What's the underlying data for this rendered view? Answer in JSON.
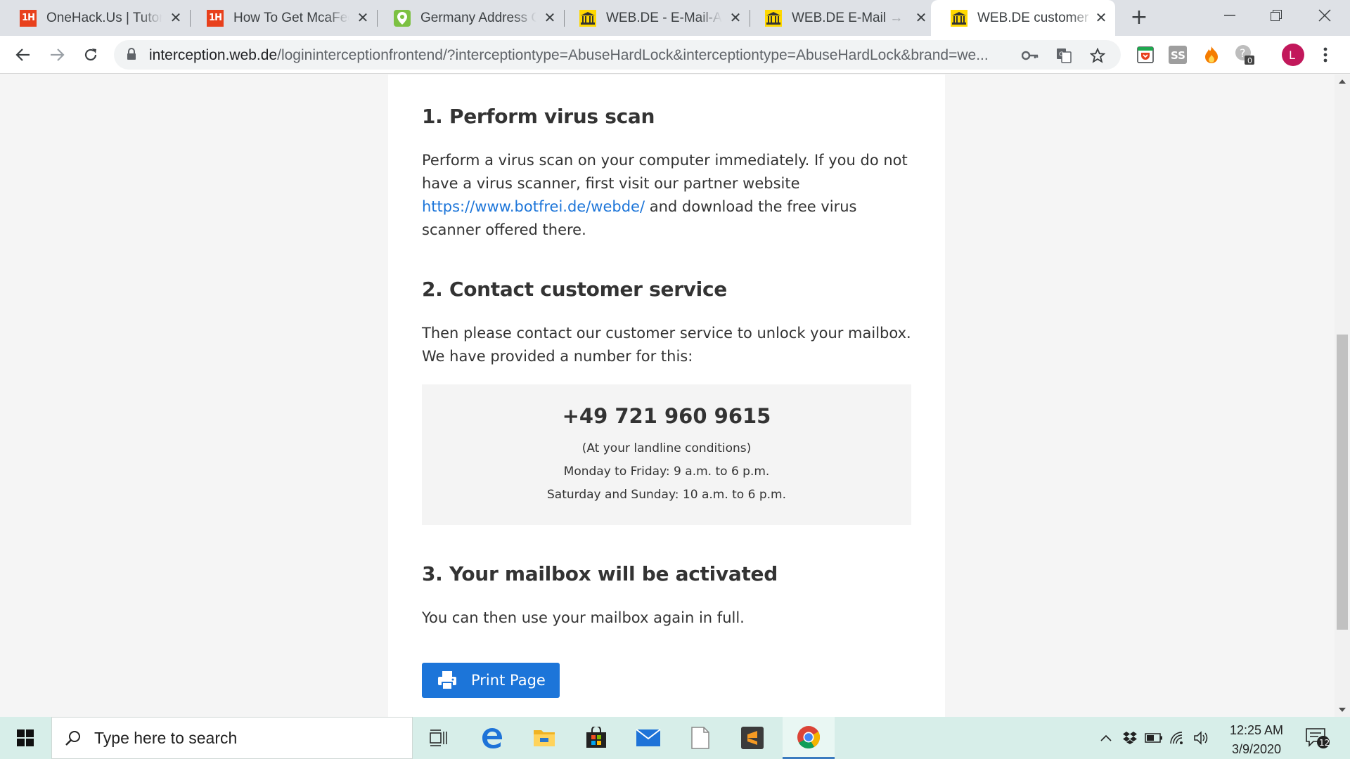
{
  "browser": {
    "tabs": [
      {
        "title": "OneHack.Us | Tutorials",
        "favicon": "onehack-icon"
      },
      {
        "title": "How To Get McaFee Total",
        "favicon": "onehack-icon"
      },
      {
        "title": "Germany Address Generator",
        "favicon": "location-pin-icon"
      },
      {
        "title": "WEB.DE - E-Mail-Adresse",
        "favicon": "webde-icon"
      },
      {
        "title": "WEB.DE E-Mail → kostenlos",
        "favicon": "webde-icon"
      },
      {
        "title": "WEB.DE customer center",
        "favicon": "webde-icon",
        "active": true
      }
    ],
    "url_host": "interception.web.de",
    "url_path": "/logininterceptionfrontend/?interceptiontype=AbuseHardLock&interceptiontype=AbuseHardLock&brand=we...",
    "profile_initial": "L",
    "ext_badge": "0"
  },
  "content": {
    "step1": {
      "heading": "1. Perform virus scan",
      "text_before": "Perform a virus scan on your computer immediately. If you do not have a virus scanner, first visit our partner website ",
      "link": "https://www.botfrei.de/webde/",
      "text_after": " and download the free virus scanner offered there."
    },
    "step2": {
      "heading": "2. Contact customer service",
      "text": "Then please contact our customer service to unlock your mailbox. We have provided a number for this:"
    },
    "contact": {
      "phone": "+49 721 960 9615",
      "note": "(At your landline conditions)",
      "weekdays": "Monday to Friday: 9 a.m. to 6 p.m.",
      "weekend": "Saturday and Sunday: 10 a.m. to 6 p.m."
    },
    "step3": {
      "heading": "3. Your mailbox will be activated",
      "text": "You can then use your mailbox again in full."
    },
    "print_label": "Print Page"
  },
  "taskbar": {
    "search_placeholder": "Type here to search",
    "time": "12:25 AM",
    "date": "3/9/2020",
    "notification_count": "12"
  },
  "colors": {
    "link": "#1c75d9",
    "button": "#1c75d9",
    "tabstrip": "#dee1e6",
    "taskbar": "#d7eee9"
  }
}
